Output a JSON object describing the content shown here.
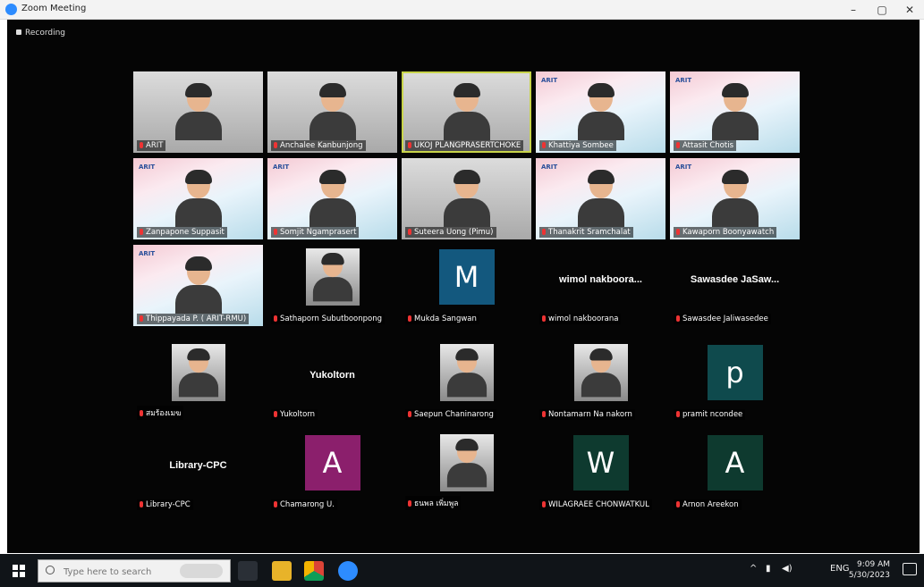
{
  "window": {
    "title": "Zoom Meeting",
    "minimize": "–",
    "maximize": "▢",
    "close": "✕"
  },
  "recording": "Recording",
  "participants": [
    {
      "name": "ARIT",
      "kind": "photo"
    },
    {
      "name": "Anchalee Kanbunjong",
      "kind": "photo"
    },
    {
      "name": "UKOJ PLANGPRASERTCHOKE",
      "kind": "photo",
      "selected": true
    },
    {
      "name": "Khattiya Sombee",
      "kind": "avatar"
    },
    {
      "name": "Attasit Chotis",
      "kind": "avatar"
    },
    {
      "name": "Zanpapone Suppasit",
      "kind": "avatar"
    },
    {
      "name": "Somjit Ngamprasert",
      "kind": "avatar"
    },
    {
      "name": "Suteera Uong (Pimu)",
      "kind": "photo"
    },
    {
      "name": "Thanakrit Sramchalat",
      "kind": "avatar"
    },
    {
      "name": "Kawaporn Boonyawatch",
      "kind": "avatar"
    },
    {
      "name": "Thippayada P. ( ARIT-RMU)",
      "kind": "avatar"
    },
    {
      "name": "Sathaporn Subutboonpong",
      "kind": "pic"
    },
    {
      "name": "Mukda Sangwan",
      "kind": "initial",
      "initial": "M",
      "color": "#13587e"
    },
    {
      "name": "wimol nakboorana",
      "kind": "text",
      "display": "wimol nakboora..."
    },
    {
      "name": "Sawasdee Jaliwasedee",
      "kind": "text",
      "display": "Sawasdee JaSaw..."
    },
    {
      "name": "สมร้องเมฆ",
      "kind": "pic"
    },
    {
      "name": "Yukoltorn",
      "kind": "text",
      "display": "Yukoltorn"
    },
    {
      "name": "Saepun Chaninarong",
      "kind": "pic"
    },
    {
      "name": "Nontamarn Na nakorn",
      "kind": "pic"
    },
    {
      "name": "pramit ncondee",
      "kind": "initial",
      "initial": "p",
      "color": "#0f4a4d"
    },
    {
      "name": "Library-CPC",
      "kind": "text",
      "display": "Library-CPC"
    },
    {
      "name": "Chamarong U.",
      "kind": "initial",
      "initial": "A",
      "color": "#8b1f6c"
    },
    {
      "name": "ธนพล เพิ่มพูล",
      "kind": "pic"
    },
    {
      "name": "WILAGRAEE CHONWATKUL",
      "kind": "initial",
      "initial": "W",
      "color": "#0e3a2f"
    },
    {
      "name": "Arnon Areekon",
      "kind": "initial",
      "initial": "A",
      "color": "#0e3a2f"
    }
  ],
  "taskbar": {
    "search_placeholder": "Type here to search",
    "time": "9:09 AM",
    "date": "5/30/2023",
    "lang": "ENG",
    "tray_icons": [
      "chevron-up-icon",
      "network-icon",
      "volume-icon"
    ]
  }
}
